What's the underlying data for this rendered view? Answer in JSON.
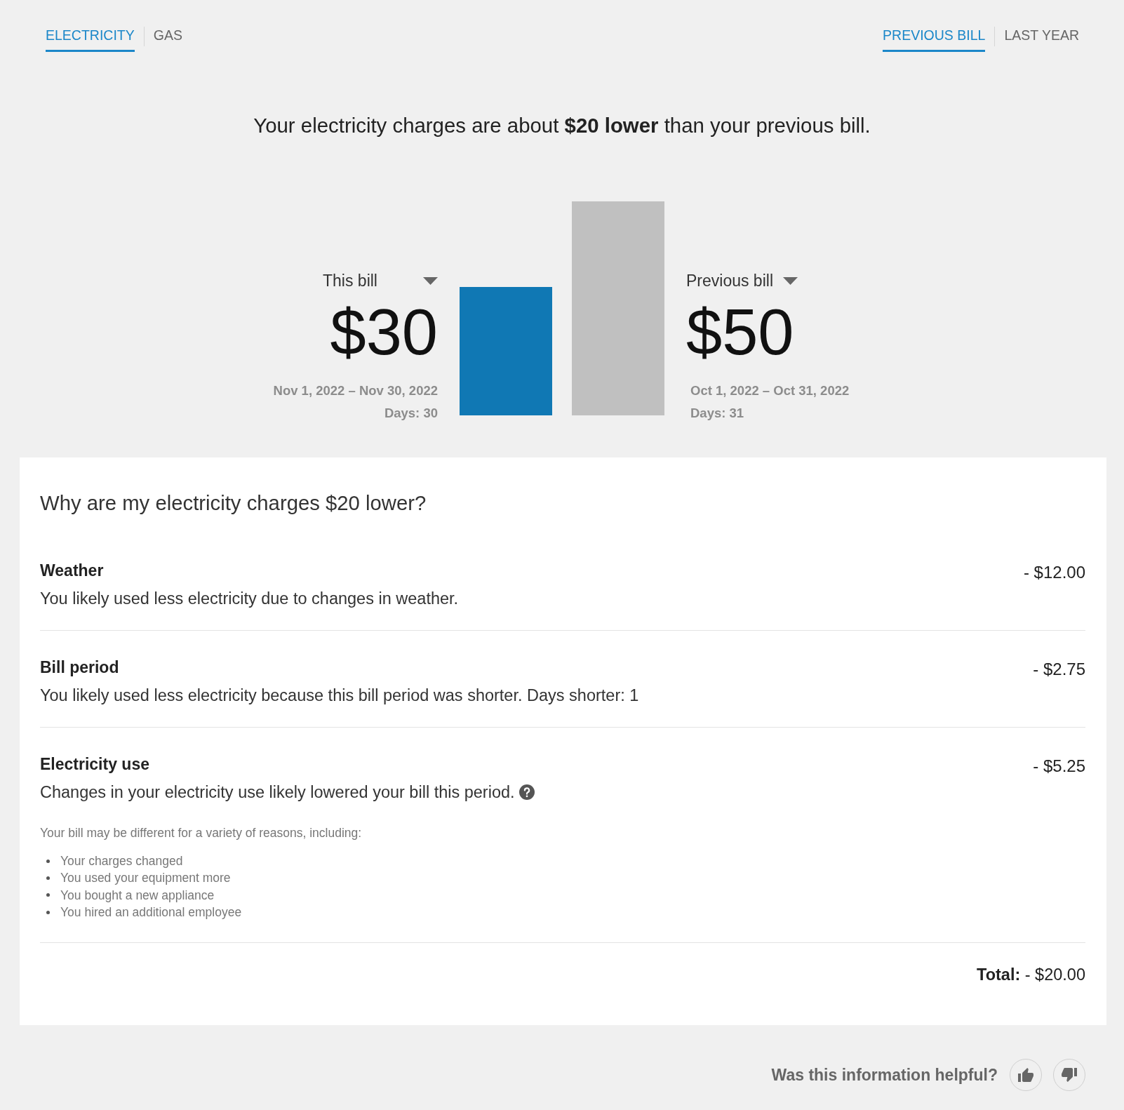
{
  "tabs": [
    {
      "label": "ELECTRICITY",
      "selected": true
    },
    {
      "label": "GAS",
      "selected": false
    }
  ],
  "compare_tabs": [
    {
      "label": "PREVIOUS BILL",
      "selected": true
    },
    {
      "label": "LAST YEAR",
      "selected": false
    }
  ],
  "headline": "Your electricity charges are about **$20 lower** than your previous bill.",
  "comparison": {
    "bills": [
      {
        "label": "This bill",
        "amount": "$30",
        "period": "Nov 1, 2022 – Nov 30, 2022",
        "days": "Days: 30",
        "color": "#1078b4"
      },
      {
        "label": "Previous bill",
        "amount": "$50",
        "period": "Oct 1, 2022 – Oct 31, 2022",
        "days": "Days: 31",
        "color": "#c0c0c0"
      }
    ]
  },
  "breakdown": {
    "heading": "Why are my electricity charges $20 lower?",
    "reasons": [
      {
        "title": "Weather",
        "description": "You likely used less electricity due to changes in weather.",
        "help": false,
        "amount": "- $12.00"
      },
      {
        "title": "Bill period",
        "description": "You likely used less electricity because this bill period was shorter. Days shorter: 1",
        "help": false,
        "amount": "- $2.75"
      },
      {
        "title": "Electricity use",
        "description": "Changes in your electricity use likely lowered your bill this period.",
        "help": true,
        "amount": "- $5.25",
        "note": "Your bill may be different for a variety of reasons, including:",
        "bullets": [
          "Your charges changed",
          "You used your equipment more",
          "You bought a new appliance",
          "You hired an additional employee"
        ]
      }
    ],
    "total": "**Total:** - $20.00"
  },
  "feedback": {
    "question": "Was this information helpful?"
  }
}
